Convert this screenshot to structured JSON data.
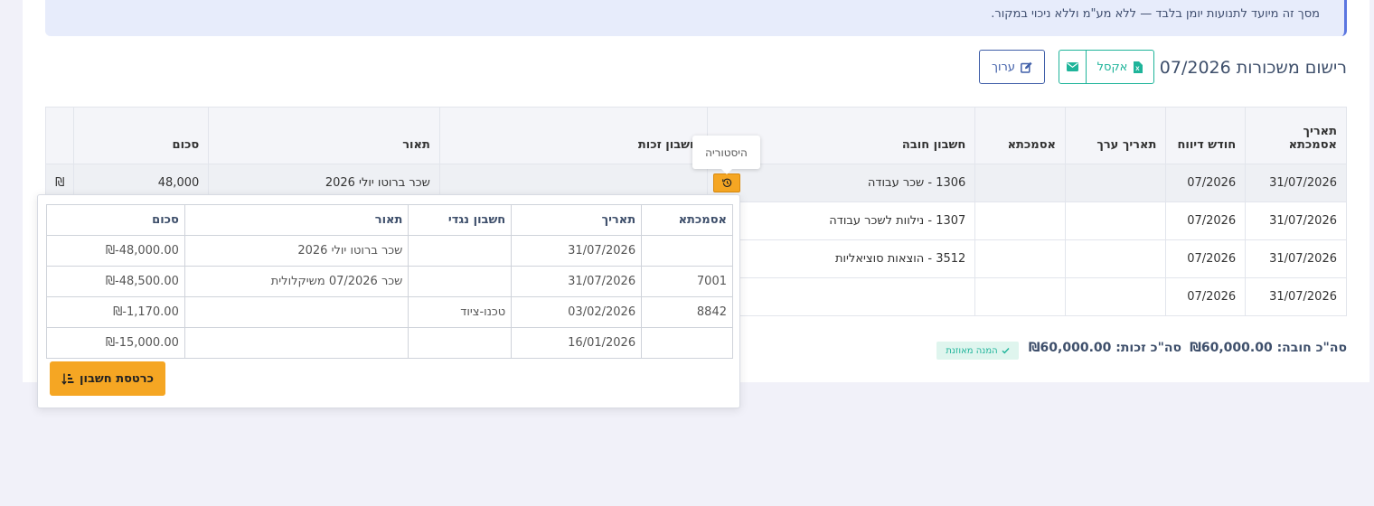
{
  "info_text": "מסך זה מיועד לתנועות יומן בלבד — ללא מע\"מ וללא ניכוי במקור.",
  "page_title": "רישום משכורות 07/2026",
  "toolbar": {
    "excel_label": "אקסל",
    "edit_label": "ערוך"
  },
  "main_table": {
    "headers": {
      "ref_date": "תאריך אסמכתא",
      "report_month": "חודש דיווח",
      "value_date": "תאריך ערך",
      "reference": "אסמכתא",
      "debit_account": "חשבון חובה",
      "credit_account": "חשבון זכות",
      "description": "תאור",
      "amount": "סכום"
    },
    "rows": [
      {
        "ref_date": "31/07/2026",
        "report_month": "07/2026",
        "value_date": "",
        "reference": "",
        "debit_account": "1306 - שכר עבודה",
        "credit_account": "",
        "description": "שכר ברוטו יולי 2026",
        "amount": "48,000",
        "currency": "₪"
      },
      {
        "ref_date": "31/07/2026",
        "report_month": "07/2026",
        "value_date": "",
        "reference": "",
        "debit_account": "1307 - נילוות לשכר עבודה",
        "credit_account": "",
        "description": "",
        "amount": "",
        "currency": ""
      },
      {
        "ref_date": "31/07/2026",
        "report_month": "07/2026",
        "value_date": "",
        "reference": "",
        "debit_account": "3512 - הוצאות סוציאליות",
        "credit_account": "",
        "description": "",
        "amount": "",
        "currency": ""
      },
      {
        "ref_date": "31/07/2026",
        "report_month": "07/2026",
        "value_date": "",
        "reference": "",
        "debit_account": "",
        "credit_account": "",
        "description": "",
        "amount": "",
        "currency": ""
      }
    ]
  },
  "history_tooltip": "היסטוריה",
  "totals": {
    "debit_label": "סה\"כ חובה:",
    "debit_value": "₪60,000.00",
    "credit_label": "סה\"כ זכות:",
    "credit_value": "₪60,000.00",
    "balanced_label": "המנה מאוזנת"
  },
  "history_popover": {
    "headers": {
      "reference": "אסמכתא",
      "date": "תאריך",
      "counter_account": "חשבון נגדי",
      "description": "תאור",
      "amount": "סכום"
    },
    "rows": [
      {
        "reference": "",
        "date": "31/07/2026",
        "counter_account": "",
        "description": "שכר ברוטו יולי 2026",
        "amount": "₪-48,000.00"
      },
      {
        "reference": "7001",
        "date": "31/07/2026",
        "counter_account": "",
        "description": "שכר 07/2026 משיקלולית",
        "amount": "₪-48,500.00"
      },
      {
        "reference": "8842",
        "date": "03/02/2026",
        "counter_account": "טכנו-ציוד",
        "description": "",
        "amount": "₪-1,170.00"
      },
      {
        "reference": "",
        "date": "16/01/2026",
        "counter_account": "",
        "description": "",
        "amount": "₪-15,000.00"
      }
    ],
    "ledger_button": "כרטסת חשבון"
  },
  "colors": {
    "accent_blue": "#5b76e0",
    "excel_green": "#1fb49a",
    "edit_blue": "#3f5ea8",
    "orange": "#f5a623"
  }
}
